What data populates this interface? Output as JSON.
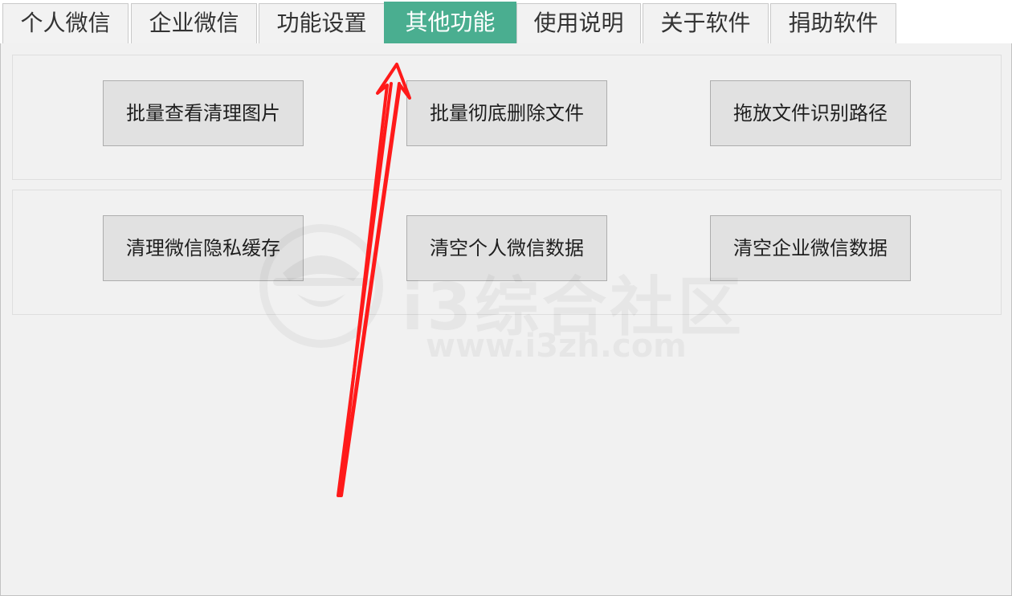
{
  "tabs": [
    {
      "label": "个人微信",
      "active": false
    },
    {
      "label": "企业微信",
      "active": false
    },
    {
      "label": "功能设置",
      "active": false
    },
    {
      "label": "其他功能",
      "active": true
    },
    {
      "label": "使用说明",
      "active": false
    },
    {
      "label": "关于软件",
      "active": false
    },
    {
      "label": "捐助软件",
      "active": false
    }
  ],
  "group1": {
    "buttons": [
      "批量查看清理图片",
      "批量彻底删除文件",
      "拖放文件识别路径"
    ]
  },
  "group2": {
    "buttons": [
      "清理微信隐私缓存",
      "清空个人微信数据",
      "清空企业微信数据"
    ]
  },
  "watermark": {
    "title": "i3综合社区",
    "url": "www.i3zh.com"
  },
  "colors": {
    "active_tab": "#4aae90",
    "annotation_arrow": "#ff1a1a"
  },
  "icons": {
    "watermark_logo": "spy-hat-icon",
    "annotation": "red-arrow-icon"
  }
}
